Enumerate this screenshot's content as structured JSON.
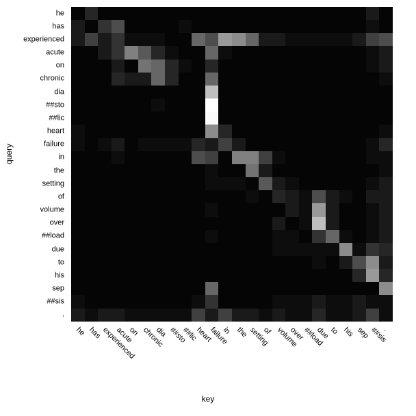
{
  "chart_data": {
    "type": "heatmap",
    "xlabel": "key",
    "ylabel": "query",
    "colorscale": "gray",
    "vmin": 0,
    "vmax": 1,
    "row_labels": [
      "he",
      "has",
      "experienced",
      "acute",
      "on",
      "chronic",
      "dia",
      "##sto",
      "##lic",
      "heart",
      "failure",
      "in",
      "the",
      "setting",
      "of",
      "volume",
      "over",
      "##load",
      "due",
      "to",
      "his",
      "sep",
      "##sis",
      "."
    ],
    "col_labels": [
      "he",
      "has",
      "experienced",
      "acute",
      "on",
      "chronic",
      "dia",
      "##sto",
      "##lic",
      "heart",
      "failure",
      "in",
      "the",
      "setting",
      "of",
      "volume",
      "over",
      "##load",
      "due",
      "to",
      "his",
      "sep",
      "##sis",
      "."
    ],
    "values": [
      [
        0.02,
        0.15,
        0.02,
        0.02,
        0.02,
        0.02,
        0.02,
        0.02,
        0.02,
        0.02,
        0.02,
        0.02,
        0.02,
        0.02,
        0.02,
        0.02,
        0.02,
        0.02,
        0.02,
        0.02,
        0.02,
        0.02,
        0.1,
        0.02
      ],
      [
        0.1,
        0.02,
        0.2,
        0.3,
        0.02,
        0.02,
        0.02,
        0.02,
        0.05,
        0.02,
        0.02,
        0.02,
        0.02,
        0.02,
        0.02,
        0.02,
        0.02,
        0.02,
        0.02,
        0.02,
        0.02,
        0.02,
        0.06,
        0.02
      ],
      [
        0.1,
        0.25,
        0.1,
        0.2,
        0.05,
        0.05,
        0.05,
        0.02,
        0.02,
        0.4,
        0.3,
        0.6,
        0.55,
        0.4,
        0.1,
        0.1,
        0.05,
        0.05,
        0.05,
        0.05,
        0.05,
        0.1,
        0.25,
        0.3
      ],
      [
        0.02,
        0.02,
        0.1,
        0.2,
        0.5,
        0.35,
        0.15,
        0.05,
        0.02,
        0.02,
        0.4,
        0.05,
        0.02,
        0.02,
        0.02,
        0.02,
        0.02,
        0.02,
        0.02,
        0.02,
        0.02,
        0.02,
        0.05,
        0.1
      ],
      [
        0.02,
        0.02,
        0.02,
        0.1,
        0.02,
        0.45,
        0.4,
        0.15,
        0.05,
        0.02,
        0.15,
        0.02,
        0.02,
        0.02,
        0.02,
        0.02,
        0.02,
        0.02,
        0.02,
        0.02,
        0.02,
        0.02,
        0.05,
        0.1
      ],
      [
        0.02,
        0.02,
        0.02,
        0.15,
        0.1,
        0.1,
        0.4,
        0.15,
        0.02,
        0.02,
        0.4,
        0.02,
        0.02,
        0.02,
        0.02,
        0.02,
        0.02,
        0.02,
        0.02,
        0.02,
        0.02,
        0.02,
        0.02,
        0.05
      ],
      [
        0.02,
        0.02,
        0.02,
        0.02,
        0.02,
        0.02,
        0.02,
        0.02,
        0.02,
        0.02,
        0.75,
        0.02,
        0.02,
        0.02,
        0.02,
        0.02,
        0.02,
        0.02,
        0.02,
        0.02,
        0.02,
        0.02,
        0.02,
        0.02
      ],
      [
        0.02,
        0.02,
        0.02,
        0.02,
        0.02,
        0.02,
        0.05,
        0.02,
        0.02,
        0.02,
        1.0,
        0.02,
        0.02,
        0.02,
        0.02,
        0.02,
        0.02,
        0.02,
        0.02,
        0.02,
        0.02,
        0.02,
        0.02,
        0.02
      ],
      [
        0.02,
        0.02,
        0.02,
        0.02,
        0.02,
        0.02,
        0.02,
        0.02,
        0.02,
        0.02,
        0.98,
        0.02,
        0.02,
        0.02,
        0.02,
        0.02,
        0.02,
        0.02,
        0.02,
        0.02,
        0.02,
        0.02,
        0.02,
        0.02
      ],
      [
        0.05,
        0.02,
        0.02,
        0.02,
        0.02,
        0.02,
        0.02,
        0.02,
        0.02,
        0.02,
        0.55,
        0.15,
        0.02,
        0.02,
        0.02,
        0.02,
        0.02,
        0.02,
        0.02,
        0.02,
        0.02,
        0.02,
        0.02,
        0.05
      ],
      [
        0.05,
        0.02,
        0.05,
        0.1,
        0.02,
        0.05,
        0.05,
        0.05,
        0.05,
        0.15,
        0.1,
        0.25,
        0.1,
        0.02,
        0.02,
        0.02,
        0.02,
        0.02,
        0.02,
        0.02,
        0.02,
        0.02,
        0.05,
        0.15
      ],
      [
        0.02,
        0.02,
        0.02,
        0.05,
        0.02,
        0.02,
        0.02,
        0.02,
        0.02,
        0.3,
        0.25,
        0.02,
        0.5,
        0.5,
        0.25,
        0.05,
        0.02,
        0.02,
        0.02,
        0.02,
        0.02,
        0.02,
        0.05,
        0.05
      ],
      [
        0.02,
        0.02,
        0.02,
        0.02,
        0.02,
        0.02,
        0.02,
        0.02,
        0.02,
        0.02,
        0.05,
        0.02,
        0.02,
        0.45,
        0.1,
        0.02,
        0.02,
        0.02,
        0.02,
        0.02,
        0.02,
        0.02,
        0.02,
        0.05
      ],
      [
        0.02,
        0.02,
        0.02,
        0.02,
        0.02,
        0.02,
        0.02,
        0.02,
        0.02,
        0.02,
        0.05,
        0.05,
        0.05,
        0.02,
        0.35,
        0.1,
        0.05,
        0.02,
        0.02,
        0.02,
        0.02,
        0.02,
        0.05,
        0.1
      ],
      [
        0.02,
        0.02,
        0.02,
        0.02,
        0.02,
        0.02,
        0.02,
        0.02,
        0.02,
        0.02,
        0.02,
        0.02,
        0.02,
        0.05,
        0.02,
        0.15,
        0.1,
        0.05,
        0.3,
        0.1,
        0.05,
        0.02,
        0.1,
        0.1
      ],
      [
        0.02,
        0.02,
        0.02,
        0.02,
        0.02,
        0.02,
        0.02,
        0.02,
        0.02,
        0.02,
        0.05,
        0.02,
        0.02,
        0.02,
        0.02,
        0.02,
        0.1,
        0.05,
        0.6,
        0.1,
        0.02,
        0.02,
        0.05,
        0.1
      ],
      [
        0.02,
        0.02,
        0.02,
        0.02,
        0.02,
        0.02,
        0.02,
        0.02,
        0.02,
        0.02,
        0.02,
        0.02,
        0.02,
        0.02,
        0.02,
        0.1,
        0.02,
        0.05,
        0.75,
        0.1,
        0.02,
        0.02,
        0.05,
        0.1
      ],
      [
        0.02,
        0.02,
        0.02,
        0.02,
        0.02,
        0.02,
        0.02,
        0.02,
        0.02,
        0.02,
        0.05,
        0.02,
        0.02,
        0.02,
        0.02,
        0.05,
        0.05,
        0.02,
        0.2,
        0.4,
        0.05,
        0.02,
        0.05,
        0.1
      ],
      [
        0.02,
        0.02,
        0.02,
        0.02,
        0.02,
        0.02,
        0.02,
        0.02,
        0.02,
        0.02,
        0.02,
        0.02,
        0.02,
        0.02,
        0.02,
        0.05,
        0.05,
        0.05,
        0.05,
        0.05,
        0.55,
        0.05,
        0.2,
        0.15
      ],
      [
        0.02,
        0.02,
        0.02,
        0.02,
        0.02,
        0.02,
        0.02,
        0.02,
        0.02,
        0.02,
        0.02,
        0.02,
        0.02,
        0.02,
        0.02,
        0.02,
        0.02,
        0.02,
        0.05,
        0.02,
        0.1,
        0.3,
        0.55,
        0.1
      ],
      [
        0.02,
        0.02,
        0.02,
        0.02,
        0.02,
        0.02,
        0.02,
        0.02,
        0.02,
        0.02,
        0.02,
        0.02,
        0.02,
        0.02,
        0.02,
        0.02,
        0.02,
        0.02,
        0.02,
        0.02,
        0.02,
        0.15,
        0.6,
        0.15
      ],
      [
        0.02,
        0.02,
        0.02,
        0.02,
        0.02,
        0.02,
        0.02,
        0.02,
        0.02,
        0.02,
        0.4,
        0.02,
        0.02,
        0.02,
        0.02,
        0.02,
        0.02,
        0.02,
        0.02,
        0.02,
        0.02,
        0.02,
        0.02,
        0.55
      ],
      [
        0.05,
        0.02,
        0.02,
        0.02,
        0.02,
        0.02,
        0.02,
        0.02,
        0.02,
        0.05,
        0.2,
        0.02,
        0.02,
        0.02,
        0.02,
        0.05,
        0.05,
        0.05,
        0.1,
        0.05,
        0.05,
        0.1,
        0.05,
        0.05
      ],
      [
        0.1,
        0.05,
        0.1,
        0.1,
        0.05,
        0.05,
        0.05,
        0.05,
        0.05,
        0.25,
        0.1,
        0.25,
        0.1,
        0.1,
        0.05,
        0.1,
        0.05,
        0.05,
        0.15,
        0.05,
        0.05,
        0.1,
        0.25,
        0.05
      ]
    ]
  }
}
